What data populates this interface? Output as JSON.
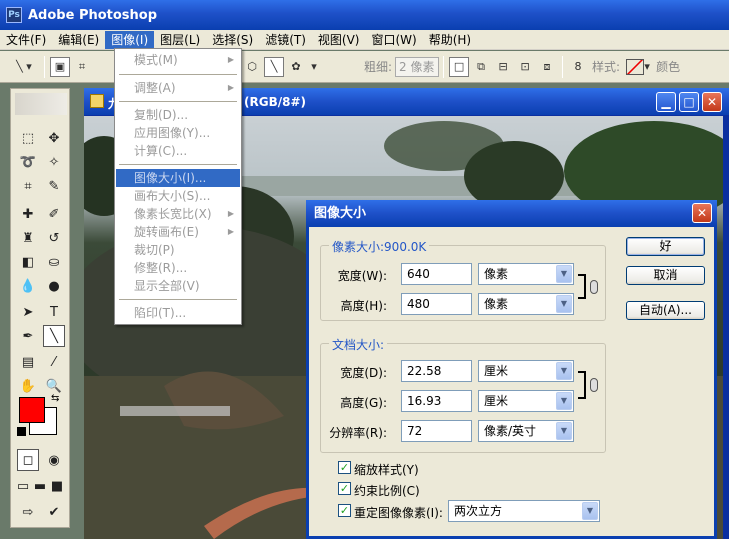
{
  "app": {
    "title": "Adobe Photoshop"
  },
  "menubar": {
    "items": [
      "文件(F)",
      "编辑(E)",
      "图像(I)",
      "图层(L)",
      "选择(S)",
      "滤镜(T)",
      "视图(V)",
      "窗口(W)",
      "帮助(H)"
    ]
  },
  "options": {
    "weight_label": "粗细:",
    "weight_value": "2 像素",
    "style_label": "样式:",
    "color_label": "颜色"
  },
  "document": {
    "title_visible": "(RGB/8#)",
    "title_prefix": "九"
  },
  "image_menu": {
    "items": [
      {
        "label": "模式(M)",
        "submenu": true,
        "highlighted": false
      },
      {
        "label": "调整(A)",
        "submenu": true,
        "highlighted": false
      },
      {
        "label": "复制(D)...",
        "submenu": false,
        "highlighted": false
      },
      {
        "label": "应用图像(Y)...",
        "submenu": false,
        "highlighted": false
      },
      {
        "label": "计算(C)...",
        "submenu": false,
        "highlighted": false
      },
      {
        "label": "图像大小(I)...",
        "submenu": false,
        "highlighted": true
      },
      {
        "label": "画布大小(S)...",
        "submenu": false,
        "highlighted": false
      },
      {
        "label": "像素长宽比(X)",
        "submenu": true,
        "highlighted": false
      },
      {
        "label": "旋转画布(E)",
        "submenu": true,
        "highlighted": false
      },
      {
        "label": "裁切(P)",
        "submenu": false,
        "highlighted": false
      },
      {
        "label": "修整(R)...",
        "submenu": false,
        "highlighted": false
      },
      {
        "label": "显示全部(V)",
        "submenu": false,
        "highlighted": false
      },
      {
        "label": "陷印(T)...",
        "submenu": false,
        "highlighted": false
      }
    ]
  },
  "dialog": {
    "title": "图像大小",
    "pixel_group_title": "像素大小:900.0K",
    "pixel_width_label": "宽度(W):",
    "pixel_width_value": "640",
    "pixel_width_unit": "像素",
    "pixel_height_label": "高度(H):",
    "pixel_height_value": "480",
    "pixel_height_unit": "像素",
    "doc_group_title": "文档大小:",
    "doc_width_label": "宽度(D):",
    "doc_width_value": "22.58",
    "doc_width_unit": "厘米",
    "doc_height_label": "高度(G):",
    "doc_height_value": "16.93",
    "doc_height_unit": "厘米",
    "resolution_label": "分辨率(R):",
    "resolution_value": "72",
    "resolution_unit": "像素/英寸",
    "ok_label": "好",
    "cancel_label": "取消",
    "auto_label": "自动(A)...",
    "scale_styles_label": "缩放样式(Y)",
    "scale_styles_checked": true,
    "constrain_label": "约束比例(C)",
    "constrain_checked": true,
    "resample_label": "重定图像像素(I):",
    "resample_checked": true,
    "resample_method": "两次立方"
  },
  "colors": {
    "foreground": "#ff0000",
    "background": "#ffffff",
    "accent": "#316ac5"
  }
}
